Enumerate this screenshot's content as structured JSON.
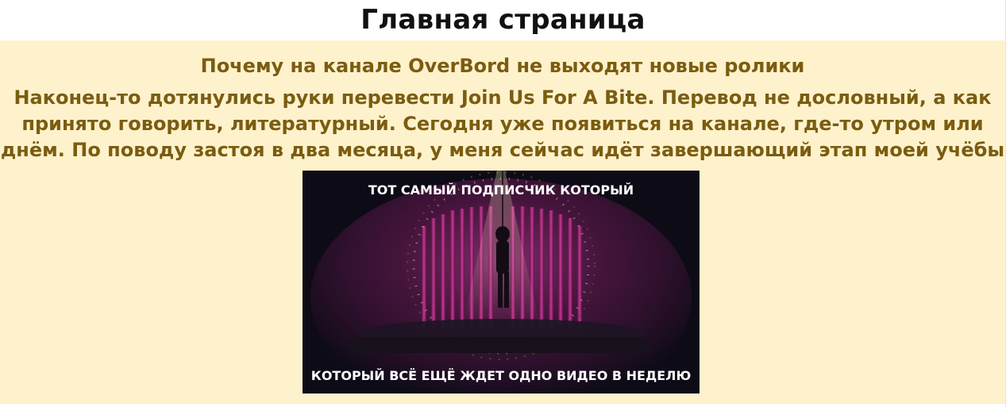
{
  "header": {
    "title": "Главная страница"
  },
  "post": {
    "title": "Почему на канале OverBord не выходят новые ролики",
    "body": "Наконец-то дотянулись руки перевести Join Us For A Bite. Перевод не дословный, а как принято говорить, литературный. Сегодня уже появиться на канале, где-то утром или днём. По поводу застоя в два месяца, у меня сейчас идёт завершающий этап моей учёбы",
    "image": {
      "top_caption": "ТОТ САМЫЙ ПОДПИСЧИК КОТОРЫЙ",
      "bottom_caption": "КОТОРЫЙ ВСЁ ЕЩЁ ЖДЕТ ОДНО ВИДЕО В НЕДЕЛЮ"
    }
  },
  "colors": {
    "post_background": "#fdf2cc",
    "post_text": "#7b5c10",
    "title_text": "#111111",
    "curtain_magenta": "#c2308f"
  }
}
